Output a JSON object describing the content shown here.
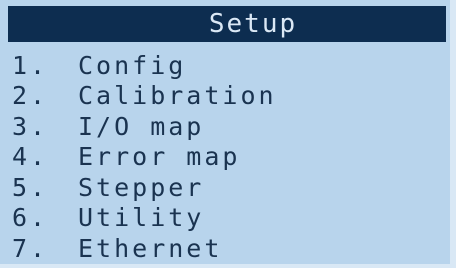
{
  "title": "Setup",
  "menu": {
    "items": [
      {
        "number": "1.",
        "label": "Config"
      },
      {
        "number": "2.",
        "label": "Calibration"
      },
      {
        "number": "3.",
        "label": "I/O map"
      },
      {
        "number": "4.",
        "label": "Error map"
      },
      {
        "number": "5.",
        "label": "Stepper"
      },
      {
        "number": "6.",
        "label": "Utility"
      },
      {
        "number": "7.",
        "label": "Ethernet"
      }
    ]
  },
  "colors": {
    "background": "#b8d4ec",
    "title_bar": "#0d2d50",
    "title_text": "#dbe8f5",
    "menu_text": "#1a3350"
  }
}
